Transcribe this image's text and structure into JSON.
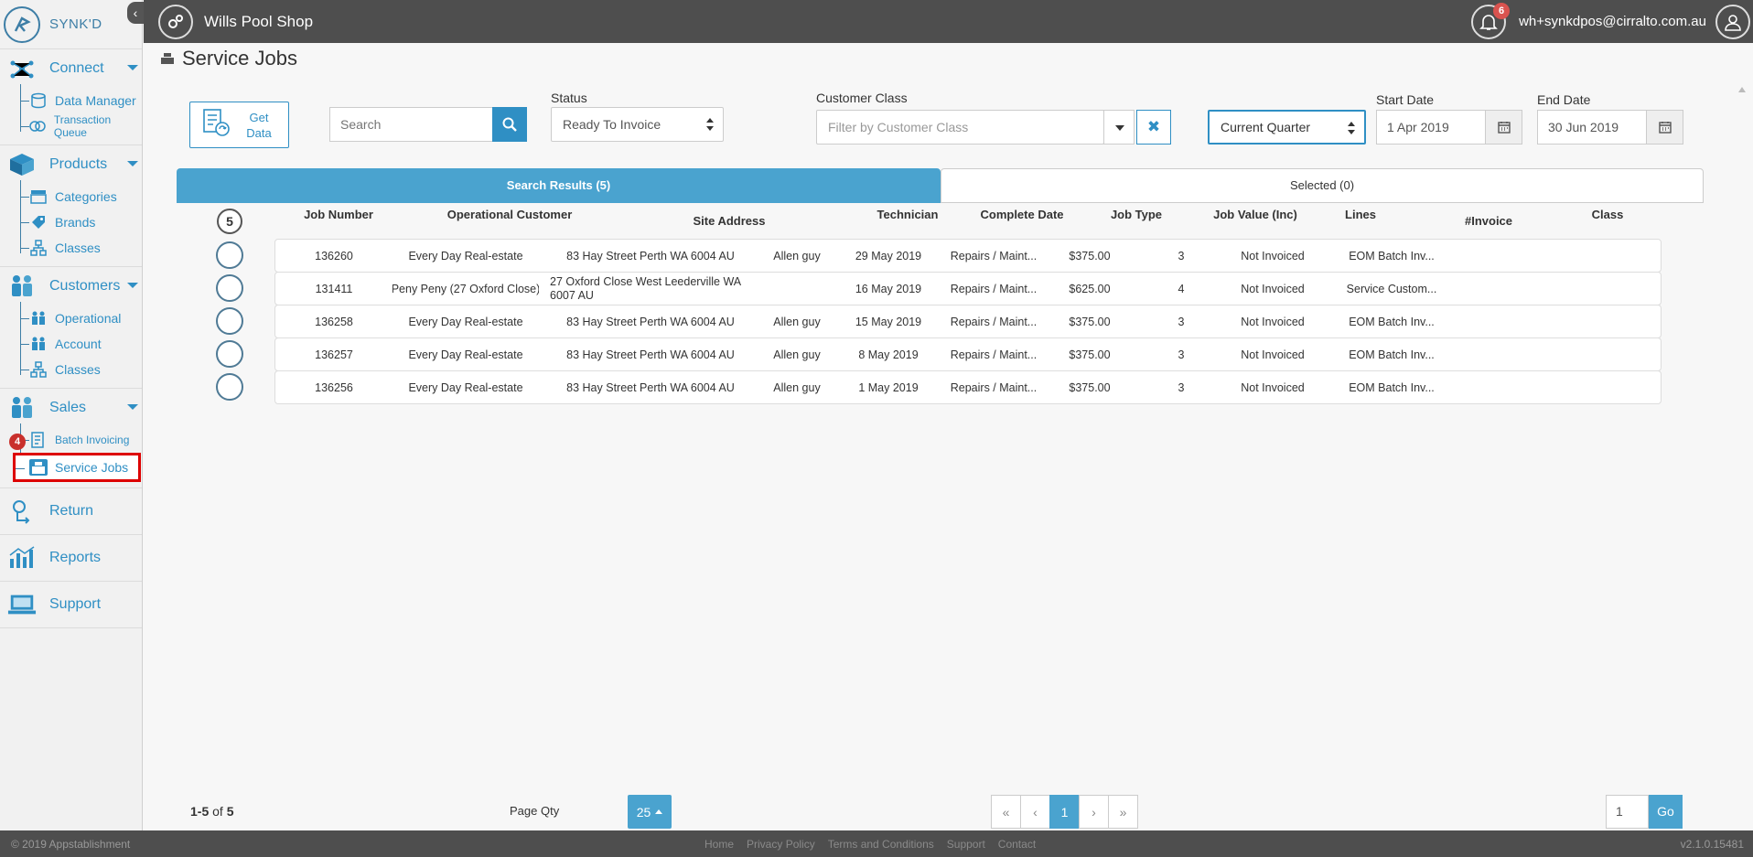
{
  "brand": {
    "name": "SYNK'D"
  },
  "sidebar": {
    "sections": [
      {
        "label": "Connect",
        "icon": "network-icon",
        "items": [
          {
            "label": "Data Manager",
            "icon": "database-icon"
          },
          {
            "label": "Transaction Queue",
            "icon": "queue-icon"
          }
        ]
      },
      {
        "label": "Products",
        "icon": "box-icon",
        "items": [
          {
            "label": "Categories",
            "icon": "category-icon"
          },
          {
            "label": "Brands",
            "icon": "tag-icon"
          },
          {
            "label": "Classes",
            "icon": "hierarchy-icon"
          }
        ]
      },
      {
        "label": "Customers",
        "icon": "people-icon",
        "items": [
          {
            "label": "Operational",
            "icon": "people-icon"
          },
          {
            "label": "Account",
            "icon": "people-icon"
          },
          {
            "label": "Classes",
            "icon": "hierarchy-icon"
          }
        ]
      },
      {
        "label": "Sales",
        "icon": "people-icon",
        "items": [
          {
            "label": "Batch Invoicing",
            "icon": "invoice-icon"
          },
          {
            "label": "Service Jobs",
            "icon": "register-icon"
          }
        ]
      }
    ],
    "singles": [
      {
        "label": "Return",
        "icon": "return-icon"
      },
      {
        "label": "Reports",
        "icon": "chart-icon"
      },
      {
        "label": "Support",
        "icon": "laptop-icon"
      }
    ],
    "step_badge": "4"
  },
  "topbar": {
    "shop_name": "Wills Pool Shop",
    "notification_count": "6",
    "user_email": "wh+synkdpos@cirralto.com.au"
  },
  "page": {
    "title": "Service Jobs"
  },
  "filters": {
    "get_data_label": "Get Data",
    "search_placeholder": "Search",
    "status_label": "Status",
    "status_value": "Ready To Invoice",
    "customer_class_label": "Customer Class",
    "customer_class_placeholder": "Filter by Customer Class",
    "period_value": "Current Quarter",
    "start_date_label": "Start Date",
    "start_date_value": "1 Apr 2019",
    "end_date_label": "End Date",
    "end_date_value": "30 Jun 2019"
  },
  "tabs": {
    "results": "Search Results (5)",
    "selected": "Selected (0)"
  },
  "table": {
    "select_count": "5",
    "columns": [
      "Job Number",
      "Operational Customer",
      "Site Address",
      "Technician",
      "Complete Date",
      "Job Type",
      "Job Value (Inc)",
      "Lines",
      "#Invoice",
      "Class"
    ],
    "rows": [
      [
        "136260",
        "Every Day Real-estate",
        "83 Hay Street Perth WA 6004 AU",
        "Allen guy",
        "29 May 2019",
        "Repairs / Maint...",
        "$375.00",
        "3",
        "Not Invoiced",
        "EOM Batch Inv..."
      ],
      [
        "131411",
        "Peny Peny (27 Oxford Close)",
        "27 Oxford Close West Leederville WA 6007 AU",
        "",
        "16 May 2019",
        "Repairs / Maint...",
        "$625.00",
        "4",
        "Not Invoiced",
        "Service Custom..."
      ],
      [
        "136258",
        "Every Day Real-estate",
        "83 Hay Street Perth WA 6004 AU",
        "Allen guy",
        "15 May 2019",
        "Repairs / Maint...",
        "$375.00",
        "3",
        "Not Invoiced",
        "EOM Batch Inv..."
      ],
      [
        "136257",
        "Every Day Real-estate",
        "83 Hay Street Perth WA 6004 AU",
        "Allen guy",
        "8 May 2019",
        "Repairs / Maint...",
        "$375.00",
        "3",
        "Not Invoiced",
        "EOM Batch Inv..."
      ],
      [
        "136256",
        "Every Day Real-estate",
        "83 Hay Street Perth WA 6004 AU",
        "Allen guy",
        "1 May 2019",
        "Repairs / Maint...",
        "$375.00",
        "3",
        "Not Invoiced",
        "EOM Batch Inv..."
      ]
    ]
  },
  "pagination": {
    "range": "1-5",
    "of_word": "of",
    "total": "5",
    "page_qty_label": "Page Qty",
    "page_qty_value": "25",
    "first": "«",
    "prev": "‹",
    "current": "1",
    "next": "›",
    "last": "»",
    "goto_value": "1",
    "go_label": "Go"
  },
  "footer": {
    "copyright": "© 2019 Appstablishment",
    "links": [
      "Home",
      "Privacy Policy",
      "Terms and Conditions",
      "Support",
      "Contact"
    ],
    "version": "v2.1.0.15481"
  },
  "colors": {
    "accent": "#2f8fc4",
    "tab_active": "#4aa3cf",
    "topbar": "#4e4e4e",
    "highlight": "#dd0000"
  }
}
